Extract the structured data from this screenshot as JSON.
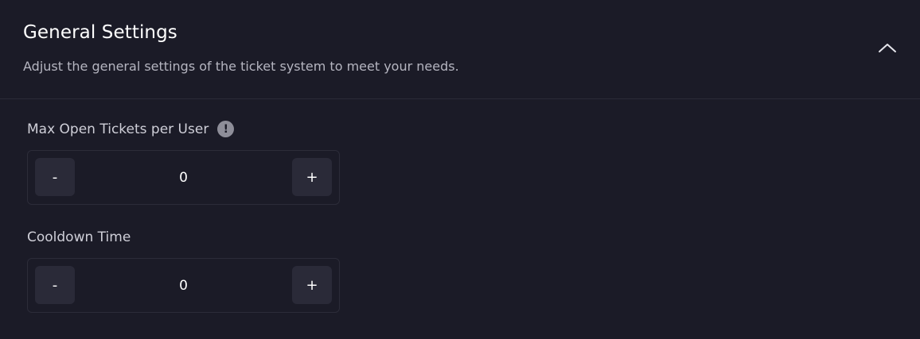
{
  "section": {
    "title": "General Settings",
    "subtitle": "Adjust the general settings of the ticket system to meet your needs.",
    "collapse_icon": "chevron-up-icon"
  },
  "fields": [
    {
      "label": "Max Open Tickets per User",
      "info_icon": "!",
      "decrement_label": "-",
      "increment_label": "+",
      "value": "0"
    },
    {
      "label": "Cooldown Time",
      "decrement_label": "-",
      "increment_label": "+",
      "value": "0"
    }
  ],
  "colors": {
    "background": "#1b1b27",
    "button": "#2a2a38",
    "border": "#2c2c39",
    "info_icon": "#8e8e99"
  }
}
